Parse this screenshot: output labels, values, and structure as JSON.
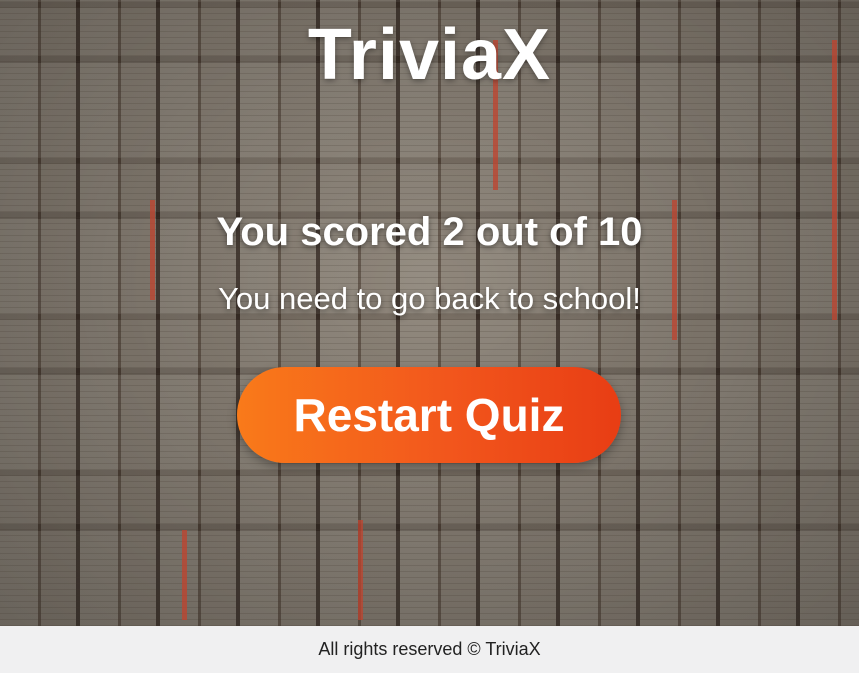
{
  "app": {
    "logo_text": "TriviaX"
  },
  "result": {
    "score_text": "You scored 2 out of 10",
    "message": "You need to go back to school!"
  },
  "actions": {
    "restart_label": "Restart Quiz"
  },
  "footer": {
    "text": "All rights reserved © TriviaX"
  },
  "colors": {
    "button_start": "#f97a1a",
    "button_end": "#e83d14",
    "text": "#ffffff",
    "footer_bg": "#f0f0f1"
  },
  "background": {
    "image": "wall of open books"
  }
}
